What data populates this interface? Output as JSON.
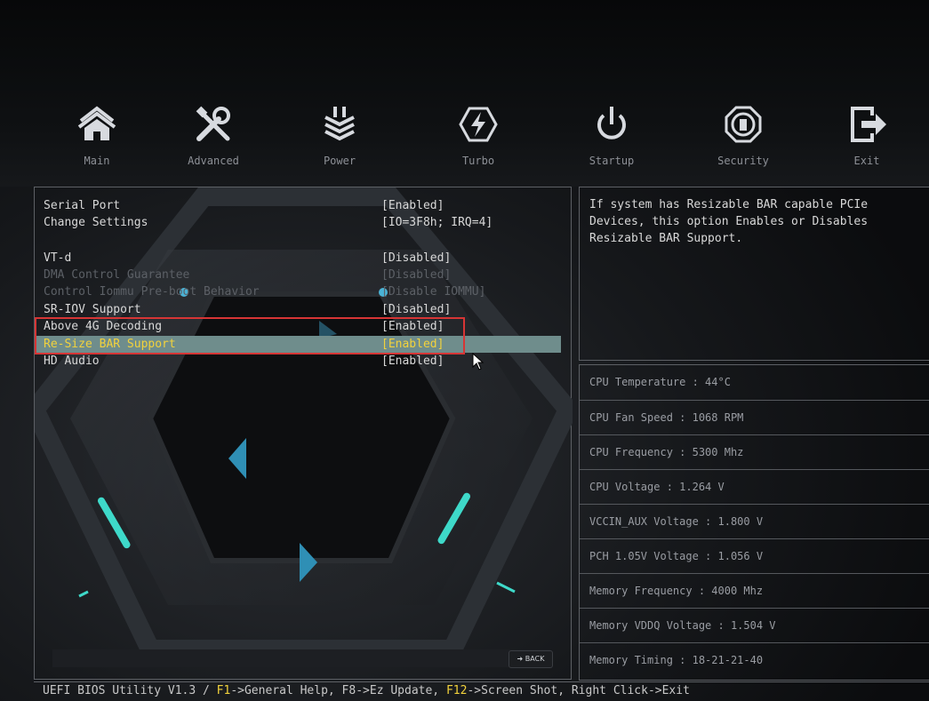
{
  "nav": [
    {
      "label": "Main",
      "icon": "home-icon"
    },
    {
      "label": "Advanced",
      "icon": "tools-icon"
    },
    {
      "label": "Power",
      "icon": "power-stack-icon"
    },
    {
      "label": "Turbo",
      "icon": "lightning-icon"
    },
    {
      "label": "Startup",
      "icon": "power-icon"
    },
    {
      "label": "Security",
      "icon": "security-icon"
    },
    {
      "label": "Exit",
      "icon": "exit-icon"
    }
  ],
  "settings": [
    {
      "label": "Serial Port",
      "value": "[Enabled]",
      "state": "normal"
    },
    {
      "label": "Change Settings",
      "value": "[IO=3F8h; IRQ=4]",
      "state": "normal"
    },
    {
      "label": "VT-d",
      "value": "[Disabled]",
      "state": "normal"
    },
    {
      "label": "DMA Control Guarantee",
      "value": "[Disabled]",
      "state": "disabled"
    },
    {
      "label": "Control Iommu Pre-boot Behavior",
      "value": "[Disable IOMMU]",
      "state": "disabled"
    },
    {
      "label": "SR-IOV Support",
      "value": "[Disabled]",
      "state": "normal"
    },
    {
      "label": "Above 4G Decoding",
      "value": "[Enabled]",
      "state": "normal"
    },
    {
      "label": "Re-Size BAR Support",
      "value": "[Enabled]",
      "state": "selected"
    },
    {
      "label": "HD Audio",
      "value": "[Enabled]",
      "state": "normal"
    }
  ],
  "back_label": "BACK",
  "help": [
    "If system has Resizable BAR capable PCIe",
    "Devices, this option Enables or Disables",
    "Resizable BAR Support."
  ],
  "stats": [
    "CPU Temperature : 44°C",
    "CPU Fan Speed : 1068 RPM",
    "CPU Frequency : 5300 Mhz",
    "CPU Voltage : 1.264 V",
    "VCCIN_AUX Voltage : 1.800 V",
    "PCH 1.05V Voltage : 1.056 V",
    "Memory Frequency : 4000 Mhz",
    "Memory VDDQ Voltage : 1.504 V",
    "Memory Timing : 18-21-21-40"
  ],
  "footer": {
    "prefix": "UEFI BIOS Utility V1.3 / ",
    "f1_key": "F1",
    "f1_text": "->General Help, F8->Ez Update, ",
    "f12_key": "F12",
    "f12_text": "->Screen Shot, Right Click->Exit"
  },
  "colors": {
    "accent_yellow": "#f2d23c",
    "selection_bar": "#6f8d8c",
    "highlight_red": "#d63535",
    "accent_blue": "#2f8fb5"
  }
}
